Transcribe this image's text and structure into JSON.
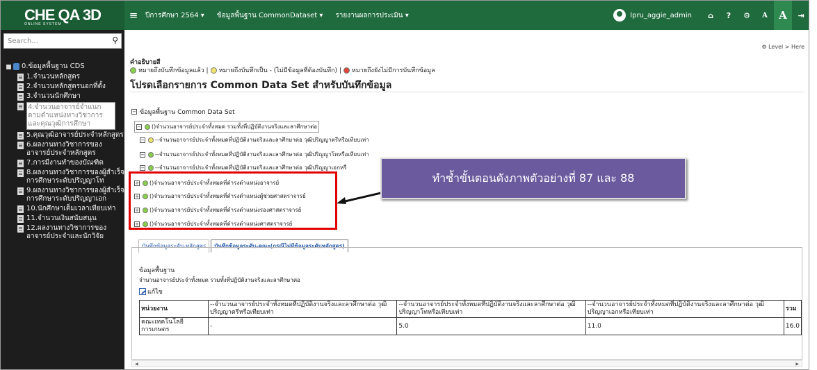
{
  "app": {
    "logo": "CHE QA 3D",
    "logo_sub": "ONLINE SYSTEM"
  },
  "topbar": {
    "menu": [
      "ปีการศึกษา 2564 ▾",
      "ข้อมูลพื้นฐาน CommonDataset ▾",
      "รายงานผลการประเมิน ▾"
    ],
    "user": "lpru_aggie_admin",
    "font_small": "A",
    "font_large": "A",
    "icons": [
      "home-icon",
      "help-icon",
      "settings-icon",
      "font-small-icon",
      "font-large-icon",
      "logout-icon"
    ]
  },
  "sidebar": {
    "search_placeholder": "Search...",
    "root": "0.ข้อมูลพื้นฐาน CDS",
    "items": [
      "1.จำนวนหลักสูตร",
      "2.จำนวนหลักสูตรนอกที่ตั้ง",
      "3.จำนวนนักศึกษา",
      "4.จำนวนอาจารย์จำแนกตามตำแหน่งทางวิชาการและคุณวุฒิการศึกษา",
      "5.คุณวุฒิอาจารย์ประจำหลักสูตร",
      "6.ผลงานทางวิชาการของอาจารย์ประจำหลักสูตร",
      "7.การมีงานทำของบัณฑิต",
      "8.ผลงานทางวิชาการของผู้สำเร็จการศึกษาระดับปริญญาโท",
      "9.ผลงานทางวิชาการของผู้สำเร็จการศึกษาระดับปริญญาเอก",
      "10.นักศึกษาเต็มเวลาเทียบเท่า",
      "11.จำนวนเงินสนับสนุน",
      "12.ผลงานทางวิชาการของอาจารย์ประจำและนักวิจัย"
    ]
  },
  "main": {
    "breadcrumb": "Level > Here",
    "legend_title": "คำอธิบายสี",
    "legend": [
      {
        "text": "หมายถึงบันทึกข้อมูลแล้ว |",
        "color": "#8ad04a"
      },
      {
        "text": "หมายถึงบันทึกเป็น - (ไม่มีข้อมูลที่ต้องบันทึก) |",
        "color": "#f2e66a"
      },
      {
        "text": "หมายถึงยังไม่มีการบันทึกข้อมูล",
        "color": "#e0463a"
      }
    ],
    "heading": "โปรดเลือกรายการ Common Data Set สำหรับบันทึกข้อมูล",
    "cds_root": "ข้อมูลพื้นฐาน Common Data Set",
    "tree": [
      "()จำนวนอาจารย์ประจำทั้งหมด รวมทั้งที่ปฏิบัติงานจริงและลาศึกษาต่อ",
      "--จำนวนอาจารย์ประจำทั้งหมดที่ปฏิบัติงานจริงและลาศึกษาต่อ วุฒิปริญญาตรีหรือเทียบเท่า",
      "--จำนวนอาจารย์ประจำทั้งหมดที่ปฏิบัติงานจริงและลาศึกษาต่อ วุฒิปริญญาโทหรือเทียบเท่า",
      "--จำนวนอาจารย์ประจำทั้งหมดที่ปฏิบัติงานจริงและลาศึกษาต่อ วุฒิปริญญาเอกหรื",
      "()จำนวนอาจารย์ประจำทั้งหมดที่ดำรงตำแหน่งอาจารย์",
      "()จำนวนอาจารย์ประจำทั้งหมดที่ดำรงตำแหน่งผู้ช่วยศาสตราจารย์",
      "()จำนวนอาจารย์ประจำทั้งหมดที่ดำรงตำแหน่งรองศาสตราจารย์",
      "()จำนวนอาจารย์ประจำทั้งหมดที่ดำรงตำแหน่งศาสตราจารย์"
    ],
    "banner": "ทำซ้ำขั้นตอนดังภาพตัวอย่างที่ 87 และ 88",
    "tabs": [
      "บันทึกข้อมูลระดับ-หลักสูตร",
      "บันทึกข้อมูลระดับ-คณะ(กรณีไม่มีข้อมูลระดับหลักสูตร)"
    ],
    "panel": {
      "title": "ข้อมูลพื้นฐาน",
      "desc": "จำนวนอาจารย์ประจำทั้งหมด รวมทั้งที่ปฏิบัติงานจริงและลาศึกษาต่อ",
      "edit": "แก้ไข",
      "table": {
        "headers": [
          "หน่วยงาน",
          "--จำนวนอาจารย์ประจำทั้งหมดที่ปฏิบัติงานจริงและลาศึกษาต่อ วุฒิปริญญาตรีหรือเทียบเท่า",
          "--จำนวนอาจารย์ประจำทั้งหมดที่ปฏิบัติงานจริงและลาศึกษาต่อ วุฒิปริญญาโทหรือเทียบเท่า",
          "--จำนวนอาจารย์ประจำทั้งหมดที่ปฏิบัติงานจริงและลาศึกษาต่อ วุฒิปริญญาเอกหรือเทียบเท่า",
          "รวม"
        ],
        "rows": [
          [
            "คณะเทคโนโลยีการเกษตร",
            "-",
            "5.0",
            "11.0",
            "16.0"
          ]
        ]
      }
    }
  }
}
